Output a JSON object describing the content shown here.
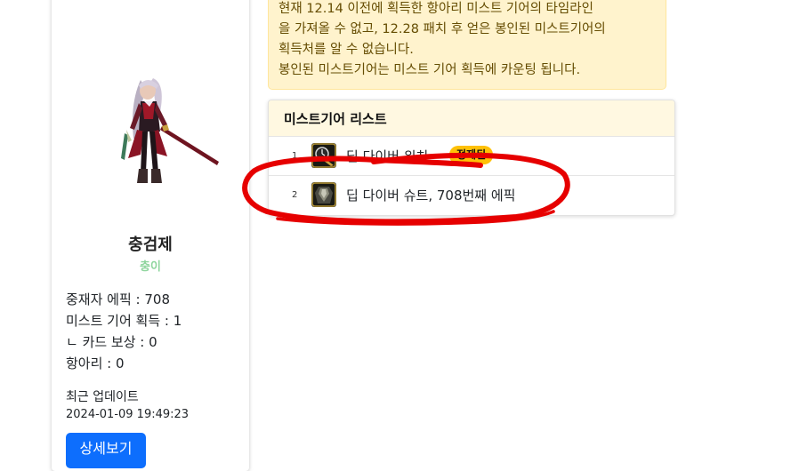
{
  "notice": {
    "lines": [
      "현재 12.14 이전에 획득한 항아리 미스트 기어의 타임라인",
      "을 가져올 수 없고, 12.28 패치 후 얻은 봉인된 미스트기어의",
      "획득처를 알 수 없습니다.",
      "봉인된 미스트기어는 미스트 기어 획득에 카운팅 됩니다."
    ]
  },
  "profile": {
    "name": "충검제",
    "job": "충이",
    "stats": [
      "중재자 에픽 : 708",
      "미스트 기어 획득 : 1",
      "ㄴ 카드 보상 : 0",
      "항아리 : 0"
    ],
    "update_label": "최근 업데이트",
    "update_time": "2024-01-09 19:49:23",
    "detail_button": "상세보기"
  },
  "gear_list": {
    "title": "미스트기어 리스트",
    "items": [
      {
        "num": "1",
        "name": "딥 다이버 워치",
        "badge": "정제된",
        "icon": "watch-icon"
      },
      {
        "num": "2",
        "name": "딥 다이버 슈트, 708번째 에픽",
        "icon": "suit-icon"
      }
    ]
  },
  "colors": {
    "notice_bg": "#fff3cd",
    "notice_text": "#664d03",
    "badge": "#ffc107",
    "button": "#0d6efd",
    "job_text": "#8fd59e",
    "annotation": "#e60000"
  }
}
